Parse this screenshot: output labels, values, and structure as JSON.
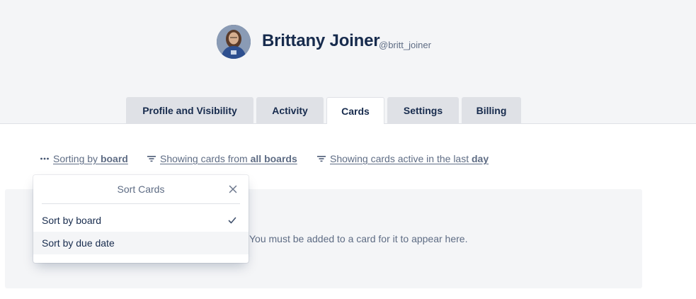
{
  "profile": {
    "name": "Brittany Joiner",
    "handle": "@britt_joiner"
  },
  "tabs": [
    {
      "label": "Profile and Visibility",
      "active": false
    },
    {
      "label": "Activity",
      "active": false
    },
    {
      "label": "Cards",
      "active": true
    },
    {
      "label": "Settings",
      "active": false
    },
    {
      "label": "Billing",
      "active": false
    }
  ],
  "filters": {
    "sort": {
      "prefix": "Sorting by ",
      "value": "board"
    },
    "boards": {
      "prefix": "Showing cards from ",
      "value": "all boards"
    },
    "active": {
      "prefix": "Showing cards active in the last ",
      "value": "day"
    }
  },
  "empty_state": {
    "message": "You must be added to a card for it to appear here."
  },
  "sort_popover": {
    "title": "Sort Cards",
    "options": [
      {
        "label": "Sort by board",
        "selected": true
      },
      {
        "label": "Sort by due date",
        "selected": false
      }
    ]
  },
  "colors": {
    "text_primary": "#172b4d",
    "text_subtle": "#5e6c84",
    "header_bg": "#f4f5f7",
    "tab_bg": "#dfe1e6"
  }
}
